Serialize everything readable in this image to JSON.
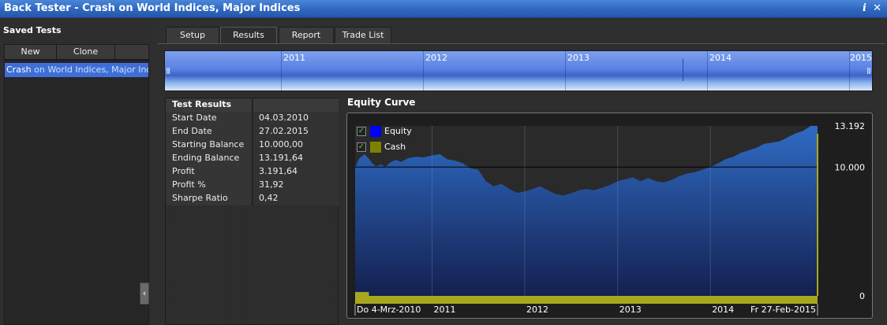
{
  "window": {
    "title": "Back Tester - Crash on World Indices, Major Indices",
    "info_icon": "i",
    "close_icon": "✕"
  },
  "sidebar": {
    "title": "Saved Tests",
    "new_label": "New",
    "clone_label": "Clone",
    "tests": [
      {
        "name_part1": "Crash",
        "name_part2": " on World Indices, Major Indices"
      }
    ],
    "collapse_glyph": "‹"
  },
  "tabs": [
    {
      "label": "Setup",
      "active": false
    },
    {
      "label": "Results",
      "active": true
    },
    {
      "label": "Report",
      "active": false
    },
    {
      "label": "Trade List",
      "active": false
    }
  ],
  "navigator": {
    "years": [
      "2011",
      "2012",
      "2013",
      "2014",
      "2015"
    ],
    "handle_left": "|||",
    "handle_right": "|||"
  },
  "results": {
    "header": "Test Results",
    "rows": [
      {
        "label": "Start Date",
        "value": "04.03.2010"
      },
      {
        "label": "End Date",
        "value": "27.02.2015"
      },
      {
        "label": "Starting Balance",
        "value": "10.000,00"
      },
      {
        "label": "Ending Balance",
        "value": "13.191,64"
      },
      {
        "label": "Profit",
        "value": "3.191,64"
      },
      {
        "label": "Profit %",
        "value": "31,92"
      },
      {
        "label": "Sharpe Ratio",
        "value": "0,42"
      }
    ]
  },
  "equity": {
    "title": "Equity Curve",
    "legend": [
      {
        "label": "Equity",
        "color": "#0000ff",
        "checked": true
      },
      {
        "label": "Cash",
        "color": "#808000",
        "checked": true
      }
    ],
    "check_glyph": "✓"
  },
  "colors": {
    "equity_fill_top": "#2f6bc4",
    "equity_fill_bottom": "#14204f",
    "cash_bar": "#a8a820",
    "baseline": "#000000"
  },
  "chart_data": {
    "type": "area",
    "title": "Equity Curve",
    "x_start_label": "Do 4-Mrz-2010",
    "x_end_label": "Fr 27-Feb-2015",
    "x_tick_labels": [
      "2011",
      "2012",
      "2013",
      "2014"
    ],
    "y_tick_labels": [
      "13.192",
      "10.000",
      "0"
    ],
    "ylim": [
      0,
      13192
    ],
    "reference_line": 10000,
    "series": [
      {
        "name": "Equity",
        "points": [
          [
            "2010-03-04",
            10000
          ],
          [
            "2010-03-20",
            10650
          ],
          [
            "2010-04-10",
            11000
          ],
          [
            "2010-04-25",
            10700
          ],
          [
            "2010-05-10",
            10300
          ],
          [
            "2010-05-25",
            10050
          ],
          [
            "2010-06-15",
            10200
          ],
          [
            "2010-07-01",
            10000
          ],
          [
            "2010-07-20",
            10350
          ],
          [
            "2010-08-10",
            10550
          ],
          [
            "2010-09-01",
            10400
          ],
          [
            "2010-10-01",
            10700
          ],
          [
            "2010-11-01",
            10800
          ],
          [
            "2010-12-01",
            10750
          ],
          [
            "2011-01-01",
            10900
          ],
          [
            "2011-02-01",
            11000
          ],
          [
            "2011-03-01",
            10600
          ],
          [
            "2011-04-01",
            10500
          ],
          [
            "2011-05-01",
            10300
          ],
          [
            "2011-06-01",
            9900
          ],
          [
            "2011-07-01",
            9800
          ],
          [
            "2011-08-01",
            8900
          ],
          [
            "2011-09-01",
            8500
          ],
          [
            "2011-10-01",
            8700
          ],
          [
            "2011-11-01",
            8300
          ],
          [
            "2011-12-01",
            8000
          ],
          [
            "2012-01-01",
            8100
          ],
          [
            "2012-02-01",
            8300
          ],
          [
            "2012-03-01",
            8500
          ],
          [
            "2012-04-01",
            8200
          ],
          [
            "2012-05-01",
            7900
          ],
          [
            "2012-06-01",
            7800
          ],
          [
            "2012-07-01",
            7950
          ],
          [
            "2012-08-01",
            8200
          ],
          [
            "2012-09-01",
            8300
          ],
          [
            "2012-10-01",
            8200
          ],
          [
            "2012-11-01",
            8400
          ],
          [
            "2012-12-01",
            8600
          ],
          [
            "2013-01-01",
            8900
          ],
          [
            "2013-02-01",
            9050
          ],
          [
            "2013-03-01",
            9200
          ],
          [
            "2013-04-01",
            8900
          ],
          [
            "2013-05-01",
            9150
          ],
          [
            "2013-06-01",
            8900
          ],
          [
            "2013-07-01",
            8800
          ],
          [
            "2013-08-01",
            9000
          ],
          [
            "2013-09-01",
            9300
          ],
          [
            "2013-10-01",
            9500
          ],
          [
            "2013-11-01",
            9600
          ],
          [
            "2013-12-01",
            9800
          ],
          [
            "2014-01-01",
            10000
          ],
          [
            "2014-02-01",
            10300
          ],
          [
            "2014-03-01",
            10600
          ],
          [
            "2014-04-01",
            10800
          ],
          [
            "2014-05-01",
            11100
          ],
          [
            "2014-06-01",
            11300
          ],
          [
            "2014-07-01",
            11500
          ],
          [
            "2014-08-01",
            11800
          ],
          [
            "2014-09-01",
            11900
          ],
          [
            "2014-10-01",
            12000
          ],
          [
            "2014-11-01",
            12300
          ],
          [
            "2014-12-01",
            12600
          ],
          [
            "2015-01-01",
            12800
          ],
          [
            "2015-02-01",
            13200
          ],
          [
            "2015-02-27",
            13192
          ]
        ]
      },
      {
        "name": "Cash",
        "points": [
          [
            "2010-03-04",
            300
          ],
          [
            "2010-03-15",
            300
          ],
          [
            "2010-03-16",
            100
          ],
          [
            "2015-02-27",
            100
          ]
        ]
      }
    ]
  }
}
